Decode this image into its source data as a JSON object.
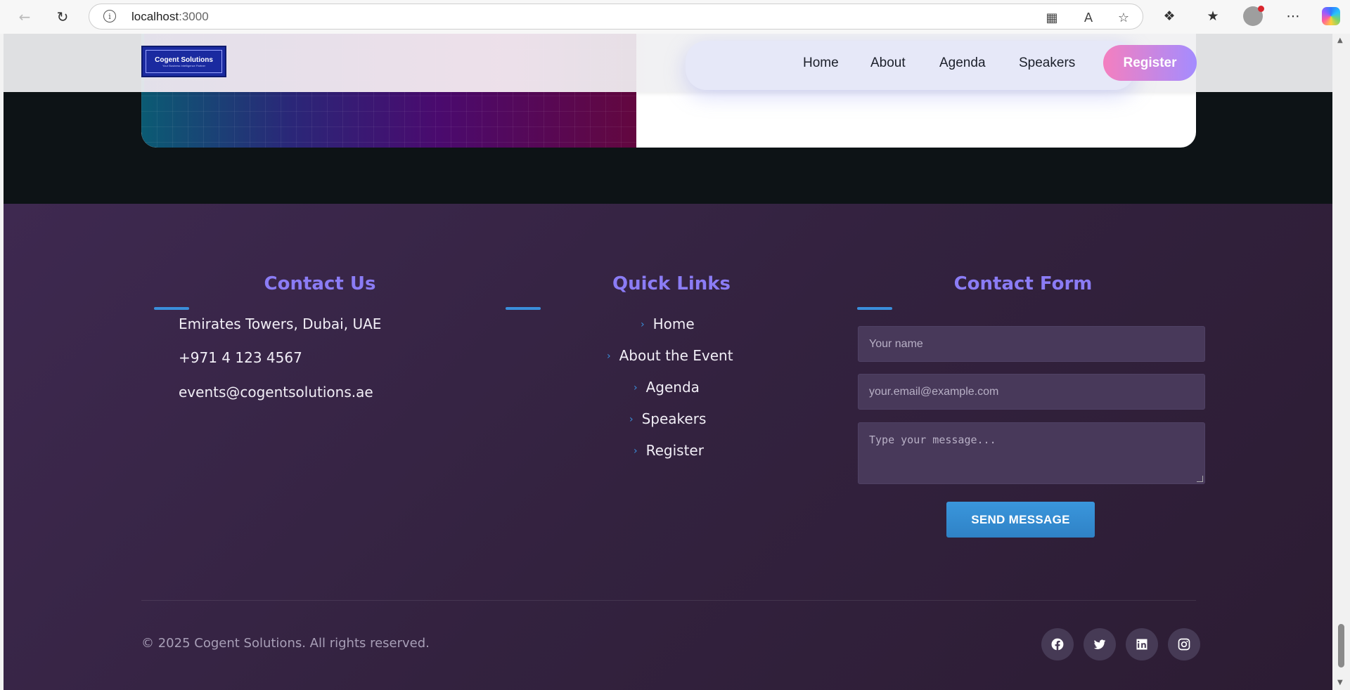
{
  "browser": {
    "url_host": "localhost",
    "url_port": ":3000"
  },
  "header": {
    "logo_text": "Cogent Solutions",
    "logo_tagline": "Your Business Intelligence Partner",
    "nav": [
      "Home",
      "About",
      "Agenda",
      "Speakers"
    ],
    "register_label": "Register"
  },
  "footer": {
    "contact": {
      "title": "Contact Us",
      "address": "Emirates Towers, Dubai, UAE",
      "phone": "+971 4 123 4567",
      "email": "events@cogentsolutions.ae"
    },
    "quick_links": {
      "title": "Quick Links",
      "items": [
        "Home",
        "About the Event",
        "Agenda",
        "Speakers",
        "Register"
      ]
    },
    "form": {
      "title": "Contact Form",
      "name_placeholder": "Your name",
      "email_placeholder": "your.email@example.com",
      "message_placeholder": "Type your message...",
      "send_label": "SEND MESSAGE"
    },
    "copyright": "© 2025 Cogent Solutions. All rights reserved.",
    "social": [
      "facebook-icon",
      "twitter-icon",
      "linkedin-icon",
      "instagram-icon"
    ]
  },
  "colors": {
    "accent_purple": "#8b7cf5",
    "accent_blue": "#3a8fdb",
    "register_gradient_start": "#f47fbf",
    "register_gradient_end": "#a48cff"
  }
}
